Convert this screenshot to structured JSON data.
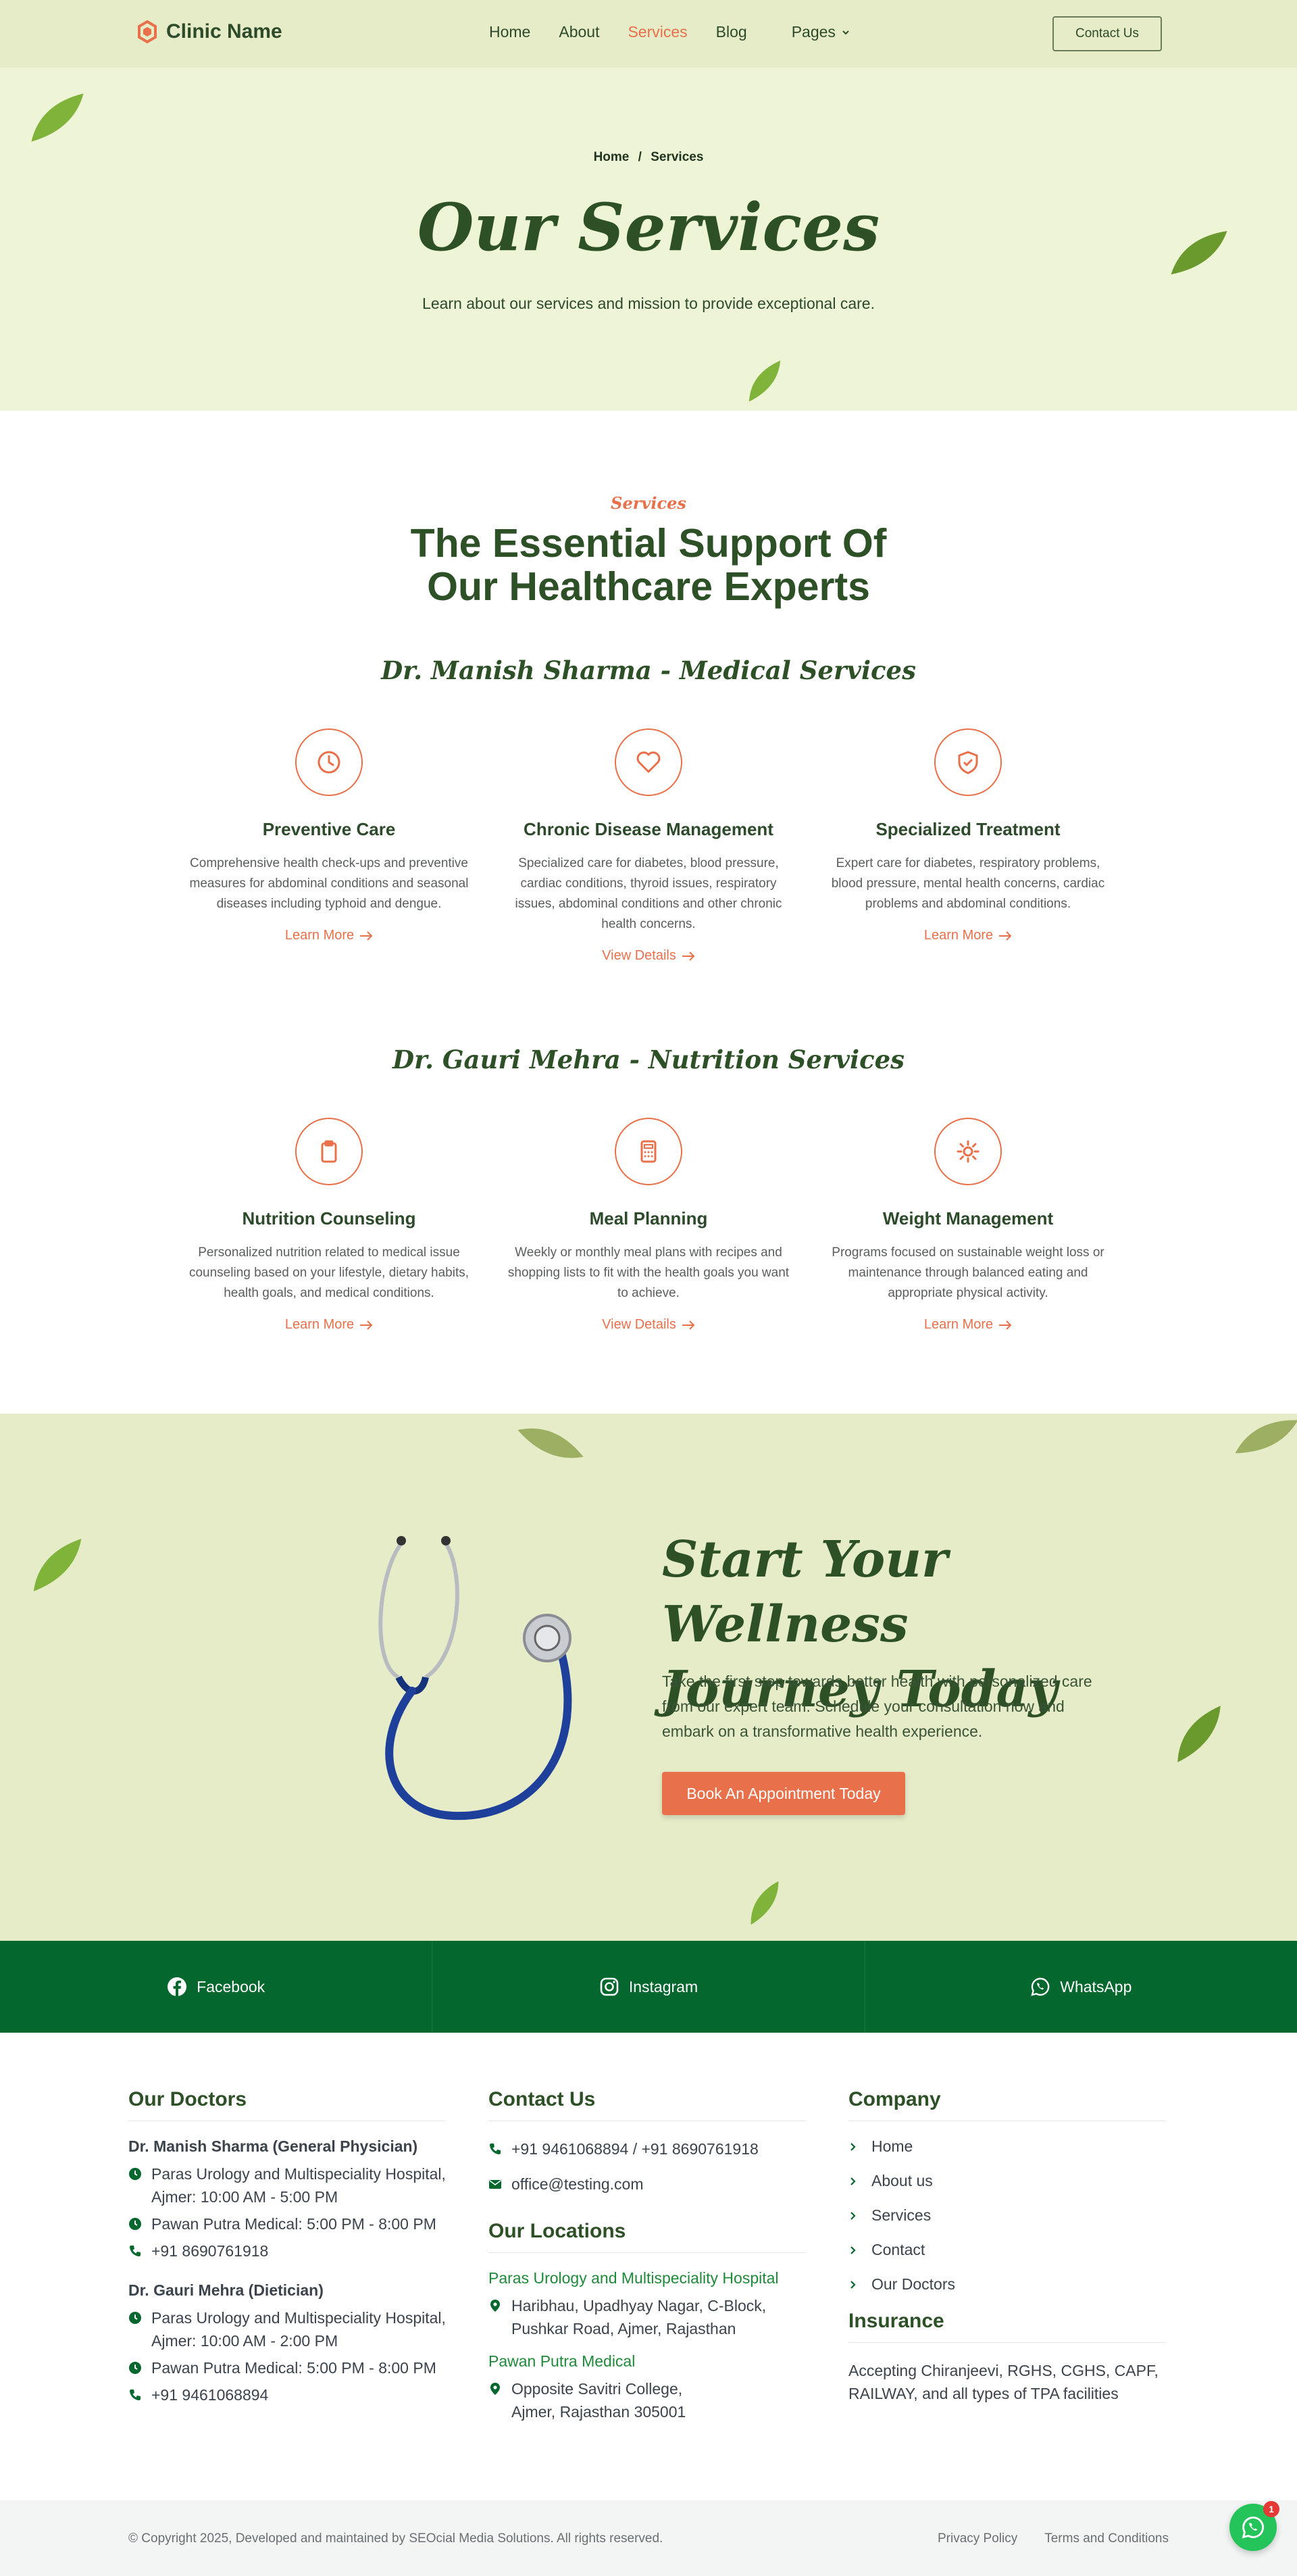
{
  "header": {
    "logo_text": "Clinic Name",
    "nav": [
      "Home",
      "About",
      "Services",
      "Blog",
      "Pages"
    ],
    "active_nav": "Services",
    "contact_btn": "Contact Us"
  },
  "hero": {
    "breadcrumb_home": "Home",
    "breadcrumb_sep": "/",
    "breadcrumb_current": "Services",
    "title": "Our Services",
    "subtitle": "Learn about our services and mission to provide exceptional care."
  },
  "services": {
    "tag": "Services",
    "title_line1": "The Essential Support Of",
    "title_line2": "Our Healthcare Experts",
    "groups": [
      {
        "title": "Dr. Manish Sharma - Medical Services",
        "cards": [
          {
            "icon": "clock-icon",
            "title": "Preventive Care",
            "desc": "Comprehensive health check-ups and preventive measures for abdominal conditions and seasonal diseases including typhoid and dengue.",
            "link": "Learn More"
          },
          {
            "icon": "heart-icon",
            "title": "Chronic Disease Management",
            "desc": "Specialized care for diabetes, blood pressure, cardiac conditions, thyroid issues, respiratory issues, abdominal conditions and other chronic health concerns.",
            "link": "View Details"
          },
          {
            "icon": "shield-check-icon",
            "title": "Specialized Treatment",
            "desc": "Expert care for diabetes, respiratory problems, blood pressure, mental health concerns, cardiac problems and abdominal conditions.",
            "link": "Learn More"
          }
        ]
      },
      {
        "title": "Dr. Gauri Mehra - Nutrition Services",
        "cards": [
          {
            "icon": "clipboard-icon",
            "title": "Nutrition Counseling",
            "desc": "Personalized nutrition related to medical issue counseling based on your lifestyle, dietary habits, health goals, and medical conditions.",
            "link": "Learn More"
          },
          {
            "icon": "calculator-icon",
            "title": "Meal Planning",
            "desc": "Weekly or monthly meal plans with recipes and shopping lists to fit with the health goals you want to achieve.",
            "link": "View Details"
          },
          {
            "icon": "sun-icon",
            "title": "Weight Management",
            "desc": "Programs focused on sustainable weight loss or maintenance through balanced eating and appropriate physical activity.",
            "link": "Learn More"
          }
        ]
      }
    ]
  },
  "cta": {
    "title_line1": "Start Your Wellness",
    "title_line2": "Journey Today",
    "text": "Take the first step towards better health with personalized care from our expert team. Schedule your consultation now and embark on a transformative health experience.",
    "button": "Book An Appointment Today"
  },
  "social": [
    "Facebook",
    "Instagram",
    "WhatsApp"
  ],
  "footer": {
    "doctors_title": "Our Doctors",
    "doctor1_name": "Dr. Manish Sharma (General Physician)",
    "doctor1_rows": [
      "Paras Urology and Multispeciality Hospital, Ajmer: 10:00 AM - 5:00 PM",
      "Pawan Putra Medical: 5:00 PM - 8:00 PM",
      "+91 8690761918"
    ],
    "doctor2_name": "Dr. Gauri Mehra (Dietician)",
    "doctor2_rows": [
      "Paras Urology and Multispeciality Hospital, Ajmer: 10:00 AM - 2:00 PM",
      "Pawan Putra Medical: 5:00 PM - 8:00 PM",
      "+91 9461068894"
    ],
    "contact_title": "Contact Us",
    "phone": "+91 9461068894 / +91 8690761918",
    "email": "office@testing.com",
    "locations_title": "Our Locations",
    "loc1_name": "Paras Urology and Multispeciality Hospital",
    "loc1_addr": "Haribhau, Upadhyay Nagar, C-Block, Pushkar Road, Ajmer, Rajasthan",
    "loc2_name": "Pawan Putra Medical",
    "loc2_addr": "Opposite Savitri College, Ajmer, Rajasthan 305001",
    "company_title": "Company",
    "company_links": [
      "Home",
      "About us",
      "Services",
      "Contact",
      "Our Doctors"
    ],
    "insurance_title": "Insurance",
    "insurance_text": "Accepting Chiranjeevi, RGHS, CGHS, CAPF, RAILWAY, and all types of TPA facilities"
  },
  "bottom": {
    "copyright": "© Copyright 2025, Developed and maintained by SEOcial Media Solutions. All rights reserved.",
    "privacy": "Privacy Policy",
    "terms": "Terms and Conditions",
    "wa_badge": "1"
  },
  "colors": {
    "accent": "#e8704a",
    "brand_green": "#2d5027",
    "social_bar": "#04672e"
  }
}
